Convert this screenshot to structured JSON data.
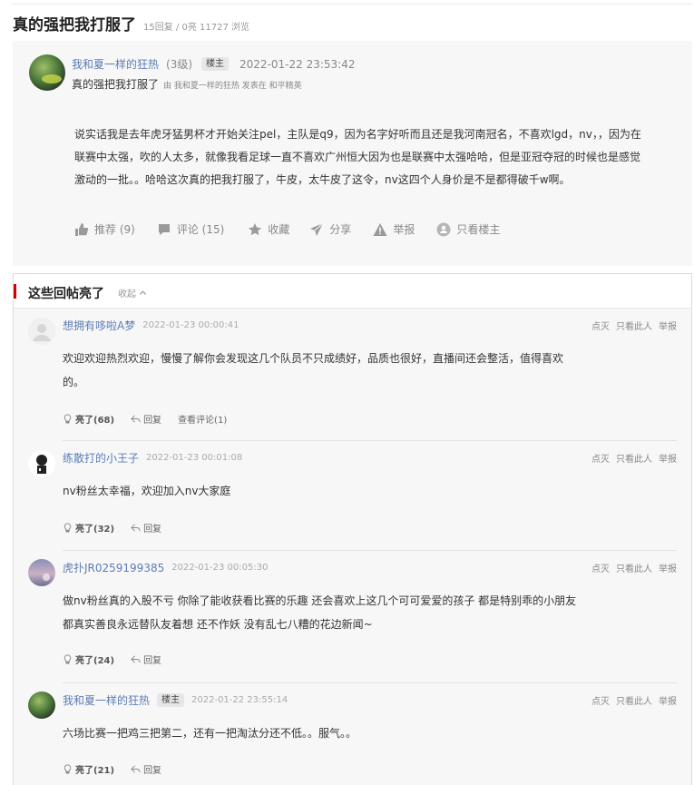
{
  "header": {
    "title": "真的强把我打服了",
    "stats": "15回复 / 0亮 11727 浏览"
  },
  "post": {
    "author": "我和夏一样的狂热",
    "level": "(3级)",
    "op_badge": "楼主",
    "time": "2022-01-22 23:53:42",
    "sub_title": "真的强把我打服了",
    "sub_meta": "由 我和夏一样的狂热 发表在 和平精英",
    "body": "说实话我是去年虎牙猛男杯才开始关注pel，主队是q9，因为名字好听而且还是我河南冠名，不喜欢lgd，nv，，因为在联赛中太强，吹的人太多，就像我看足球一直不喜欢广州恒大因为也是联赛中太强哈哈，但是亚冠夺冠的时候也是感觉激动的一批。。哈哈这次真的把我打服了，牛皮，太牛皮了这令，nv这四个人身价是不是都得破千w啊。",
    "actions": {
      "recommend": "推荐 (9)",
      "comment": "评论 (15)",
      "favorite": "收藏",
      "share": "分享",
      "report": "举报",
      "op_only": "只看楼主"
    }
  },
  "highlights": {
    "title": "这些回帖亮了",
    "collapse": "收起",
    "reply_ops": [
      "点灭",
      "只看此人",
      "举报"
    ],
    "reply_label": "回复",
    "replies": [
      {
        "author": "想拥有哆啦A梦",
        "time": "2022-01-23 00:00:41",
        "text": "欢迎欢迎热烈欢迎，慢慢了解你会发现这几个队员不只成绩好，品质也很好，直播间还会整活，值得喜欢的。",
        "likes": "亮了(68)",
        "extra": "查看评论(1)"
      },
      {
        "author": "练散打的小王子",
        "time": "2022-01-23 00:01:08",
        "text": "nv粉丝太幸福，欢迎加入nv大家庭",
        "likes": "亮了(32)"
      },
      {
        "author": "虎扑JR0259199385",
        "time": "2022-01-23 00:05:30",
        "text": "做nv粉丝真的入股不亏 你除了能收获看比赛的乐趣 还会喜欢上这几个可可爱爱的孩子 都是特别乖的小朋友 都真实善良永远替队友着想 还不作妖 没有乱七八糟的花边新闻~",
        "likes": "亮了(24)"
      },
      {
        "author": "我和夏一样的狂热",
        "op_badge": "楼主",
        "time": "2022-01-22 23:55:14",
        "text": "六场比赛一把鸡三把第二，还有一把淘汰分还不低。。服气。。",
        "likes": "亮了(21)"
      }
    ]
  }
}
